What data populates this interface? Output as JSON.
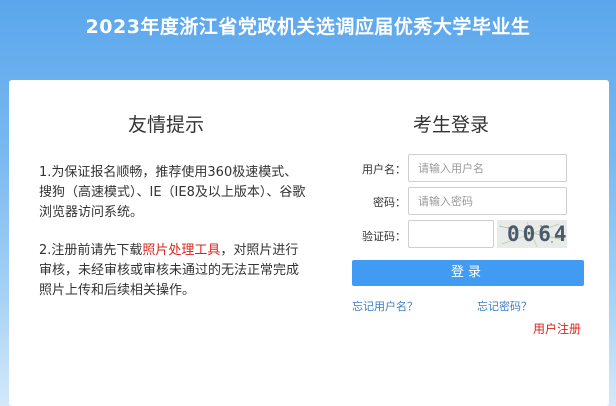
{
  "header": {
    "title": "2023年度浙江省党政机关选调应届优秀大学毕业生"
  },
  "tips": {
    "title": "友情提示",
    "item1": "1.为保证报名顺畅，推荐使用360极速模式、搜狗（高速模式）、IE（IE8及以上版本）、谷歌浏览器访问系统。",
    "item2_prefix": "2.注册前请先下载",
    "item2_link": "照片处理工具",
    "item2_suffix": "，对照片进行审核，未经审核或审核未通过的无法正常完成照片上传和后续相关操作。"
  },
  "login": {
    "title": "考生登录",
    "username_label": "用户名：",
    "username_placeholder": "请输入用户名",
    "username_value": "",
    "password_label": "密码：",
    "password_placeholder": "请输入密码",
    "password_value": "",
    "captcha_label": "验证码：",
    "captcha_value": "",
    "captcha_text": "0064",
    "submit_label": "登录",
    "forgot_username": "忘记用户名？",
    "forgot_password": "忘记密码？",
    "register": "用户注册"
  },
  "colors": {
    "accent": "#429bf2",
    "link": "#3a7fc7",
    "alert": "#d9261c"
  }
}
